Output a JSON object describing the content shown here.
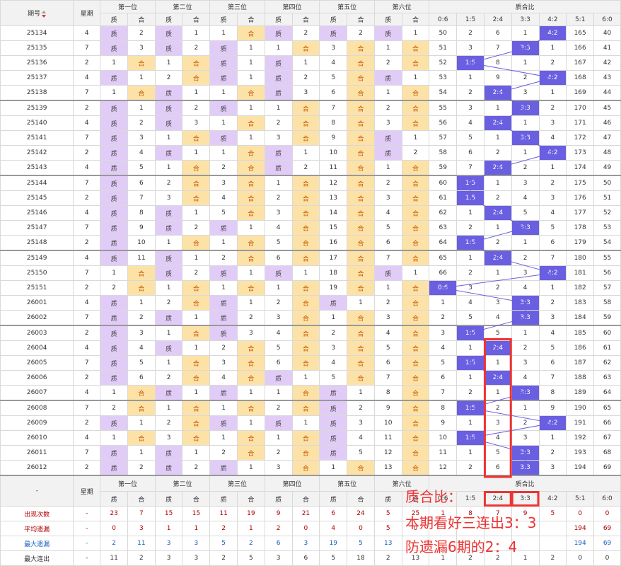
{
  "header": {
    "period_label": "期号",
    "weekday_label": "星期",
    "positions": [
      "第一位",
      "第二位",
      "第三位",
      "第四位",
      "第五位",
      "第六位"
    ],
    "ratio_group": "质合比",
    "zhi": "质",
    "he": "合",
    "ratios": [
      "0:6",
      "1:5",
      "2:4",
      "3:3",
      "4:2",
      "5:1",
      "6:0"
    ]
  },
  "rows": [
    [
      "25134",
      "4",
      "质",
      "2",
      "质",
      "1",
      "1",
      "合",
      "质",
      "2",
      "质",
      "2",
      "质",
      "1",
      "50",
      "2",
      "6",
      "1",
      "4:2",
      "165",
      "40"
    ],
    [
      "25135",
      "7",
      "质",
      "3",
      "质",
      "2",
      "质",
      "1",
      "1",
      "合",
      "3",
      "合",
      "1",
      "合",
      "51",
      "3",
      "7",
      "3:3",
      "1",
      "166",
      "41"
    ],
    [
      "25136",
      "2",
      "1",
      "合",
      "1",
      "合",
      "质",
      "1",
      "质",
      "1",
      "4",
      "合",
      "2",
      "合",
      "52",
      "1:5",
      "8",
      "1",
      "2",
      "167",
      "42"
    ],
    [
      "25137",
      "4",
      "质",
      "1",
      "2",
      "合",
      "质",
      "1",
      "质",
      "2",
      "5",
      "合",
      "质",
      "1",
      "53",
      "1",
      "9",
      "2",
      "4:2",
      "168",
      "43"
    ],
    [
      "25138",
      "7",
      "1",
      "合",
      "质",
      "1",
      "1",
      "合",
      "质",
      "3",
      "6",
      "合",
      "1",
      "合",
      "54",
      "2",
      "2:4",
      "3",
      "1",
      "169",
      "44"
    ],
    [
      "25139",
      "2",
      "质",
      "1",
      "质",
      "2",
      "质",
      "1",
      "1",
      "合",
      "7",
      "合",
      "2",
      "合",
      "55",
      "3",
      "1",
      "3:3",
      "2",
      "170",
      "45"
    ],
    [
      "25140",
      "4",
      "质",
      "2",
      "质",
      "3",
      "1",
      "合",
      "2",
      "合",
      "8",
      "合",
      "3",
      "合",
      "56",
      "4",
      "2:4",
      "1",
      "3",
      "171",
      "46"
    ],
    [
      "25141",
      "7",
      "质",
      "3",
      "1",
      "合",
      "质",
      "1",
      "3",
      "合",
      "9",
      "合",
      "质",
      "1",
      "57",
      "5",
      "1",
      "3:3",
      "4",
      "172",
      "47"
    ],
    [
      "25142",
      "2",
      "质",
      "4",
      "质",
      "1",
      "1",
      "合",
      "质",
      "1",
      "10",
      "合",
      "质",
      "2",
      "58",
      "6",
      "2",
      "1",
      "4:2",
      "173",
      "48"
    ],
    [
      "25143",
      "4",
      "质",
      "5",
      "1",
      "合",
      "2",
      "合",
      "质",
      "2",
      "11",
      "合",
      "1",
      "合",
      "59",
      "7",
      "2:4",
      "2",
      "1",
      "174",
      "49"
    ],
    [
      "25144",
      "7",
      "质",
      "6",
      "2",
      "合",
      "3",
      "合",
      "1",
      "合",
      "12",
      "合",
      "2",
      "合",
      "60",
      "1:5",
      "1",
      "3",
      "2",
      "175",
      "50"
    ],
    [
      "25145",
      "2",
      "质",
      "7",
      "3",
      "合",
      "4",
      "合",
      "2",
      "合",
      "13",
      "合",
      "3",
      "合",
      "61",
      "1:5",
      "2",
      "4",
      "3",
      "176",
      "51"
    ],
    [
      "25146",
      "4",
      "质",
      "8",
      "质",
      "1",
      "5",
      "合",
      "3",
      "合",
      "14",
      "合",
      "4",
      "合",
      "62",
      "1",
      "2:4",
      "5",
      "4",
      "177",
      "52"
    ],
    [
      "25147",
      "7",
      "质",
      "9",
      "质",
      "2",
      "质",
      "1",
      "4",
      "合",
      "15",
      "合",
      "5",
      "合",
      "63",
      "2",
      "1",
      "3:3",
      "5",
      "178",
      "53"
    ],
    [
      "25148",
      "2",
      "质",
      "10",
      "1",
      "合",
      "1",
      "合",
      "5",
      "合",
      "16",
      "合",
      "6",
      "合",
      "64",
      "1:5",
      "2",
      "1",
      "6",
      "179",
      "54"
    ],
    [
      "25149",
      "4",
      "质",
      "11",
      "质",
      "1",
      "2",
      "合",
      "6",
      "合",
      "17",
      "合",
      "7",
      "合",
      "65",
      "1",
      "2:4",
      "2",
      "7",
      "180",
      "55"
    ],
    [
      "25150",
      "7",
      "1",
      "合",
      "质",
      "2",
      "质",
      "1",
      "质",
      "1",
      "18",
      "合",
      "质",
      "1",
      "66",
      "2",
      "1",
      "3",
      "4:2",
      "181",
      "56"
    ],
    [
      "25151",
      "2",
      "2",
      "合",
      "1",
      "合",
      "1",
      "合",
      "1",
      "合",
      "19",
      "合",
      "1",
      "合",
      "0:6",
      "3",
      "2",
      "4",
      "1",
      "182",
      "57"
    ],
    [
      "26001",
      "4",
      "质",
      "1",
      "2",
      "合",
      "质",
      "1",
      "2",
      "合",
      "质",
      "1",
      "2",
      "合",
      "1",
      "4",
      "3",
      "3:3",
      "2",
      "183",
      "58"
    ],
    [
      "26002",
      "7",
      "质",
      "2",
      "质",
      "1",
      "质",
      "2",
      "3",
      "合",
      "1",
      "合",
      "3",
      "合",
      "2",
      "5",
      "4",
      "3:3",
      "3",
      "184",
      "59"
    ],
    [
      "26003",
      "2",
      "质",
      "3",
      "1",
      "合",
      "质",
      "3",
      "4",
      "合",
      "2",
      "合",
      "4",
      "合",
      "3",
      "1:5",
      "5",
      "1",
      "4",
      "185",
      "60"
    ],
    [
      "26004",
      "4",
      "质",
      "4",
      "质",
      "1",
      "2",
      "合",
      "5",
      "合",
      "3",
      "合",
      "5",
      "合",
      "4",
      "1",
      "2:4",
      "2",
      "5",
      "186",
      "61"
    ],
    [
      "26005",
      "7",
      "质",
      "5",
      "1",
      "合",
      "3",
      "合",
      "6",
      "合",
      "4",
      "合",
      "6",
      "合",
      "5",
      "1:5",
      "1",
      "3",
      "6",
      "187",
      "62"
    ],
    [
      "26006",
      "2",
      "质",
      "6",
      "2",
      "合",
      "4",
      "合",
      "质",
      "1",
      "5",
      "合",
      "7",
      "合",
      "6",
      "1",
      "2:4",
      "4",
      "7",
      "188",
      "63"
    ],
    [
      "26007",
      "4",
      "1",
      "合",
      "质",
      "1",
      "质",
      "1",
      "1",
      "合",
      "质",
      "1",
      "8",
      "合",
      "7",
      "2",
      "1",
      "3:3",
      "8",
      "189",
      "64"
    ],
    [
      "26008",
      "7",
      "2",
      "合",
      "1",
      "合",
      "1",
      "合",
      "2",
      "合",
      "质",
      "2",
      "9",
      "合",
      "8",
      "1:5",
      "2",
      "1",
      "9",
      "190",
      "65"
    ],
    [
      "26009",
      "2",
      "质",
      "1",
      "2",
      "合",
      "质",
      "1",
      "质",
      "1",
      "质",
      "3",
      "10",
      "合",
      "9",
      "1",
      "3",
      "2",
      "4:2",
      "191",
      "66"
    ],
    [
      "26010",
      "4",
      "1",
      "合",
      "3",
      "合",
      "1",
      "合",
      "1",
      "合",
      "质",
      "4",
      "11",
      "合",
      "10",
      "1:5",
      "4",
      "3",
      "1",
      "192",
      "67"
    ],
    [
      "26011",
      "7",
      "质",
      "1",
      "质",
      "1",
      "2",
      "合",
      "2",
      "合",
      "质",
      "5",
      "12",
      "合",
      "11",
      "1",
      "5",
      "3:3",
      "2",
      "193",
      "68"
    ],
    [
      "26012",
      "2",
      "质",
      "2",
      "质",
      "2",
      "质",
      "1",
      "3",
      "合",
      "1",
      "合",
      "13",
      "合",
      "12",
      "2",
      "6",
      "3:3",
      "3",
      "194",
      "69"
    ]
  ],
  "footer_period": "-",
  "stats": [
    {
      "label": "出现次数",
      "values": [
        "-",
        "23",
        "7",
        "15",
        "15",
        "11",
        "19",
        "9",
        "21",
        "6",
        "24",
        "5",
        "25",
        "1",
        "8",
        "7",
        "9",
        "5",
        "0",
        "0"
      ]
    },
    {
      "label": "平均遗漏",
      "values": [
        "-",
        "0",
        "3",
        "1",
        "1",
        "2",
        "1",
        "2",
        "0",
        "4",
        "0",
        "5",
        "0",
        "",
        "",
        "",
        "",
        "",
        "194",
        "69"
      ]
    },
    {
      "label": "最大遗漏",
      "values": [
        "-",
        "2",
        "11",
        "3",
        "3",
        "5",
        "2",
        "6",
        "3",
        "19",
        "5",
        "13",
        "",
        "",
        "",
        "",
        "",
        "",
        "194",
        "69"
      ]
    },
    {
      "label": "最大连出",
      "values": [
        "-",
        "11",
        "2",
        "3",
        "3",
        "2",
        "5",
        "3",
        "6",
        "5",
        "18",
        "2",
        "13",
        "1",
        "2",
        "2",
        "1",
        "2",
        "0",
        "0"
      ]
    }
  ],
  "annotation": {
    "line1": "质合比：",
    "line2": "本期看好三连出3：3",
    "line3": "防遗漏6期的2：4"
  },
  "colors": {
    "zhi_bg": "#e1ccf7",
    "he_bg": "#fde2a8",
    "he_text": "#c55a00",
    "highlight_bg": "#6a5fe0",
    "annotation_red": "#ee3333"
  }
}
